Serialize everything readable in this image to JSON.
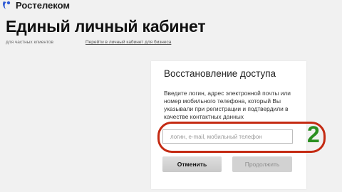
{
  "header": {
    "logo_text": "Ростелеком",
    "title": "Единый личный кабинет",
    "sub_left": "для частных клиентов",
    "sub_right_link": "Перейти в личный кабинет для бизнеса"
  },
  "recovery": {
    "title": "Восстановление доступа",
    "description": "Введите логин, адрес электронной почты или номер мобильного телефона, который Вы указывали при регистрации и подтвердили в качестве контактных данных",
    "input_placeholder": "логин, e-mail, мобильный телефон",
    "input_value": "",
    "cancel_label": "Отменить",
    "continue_label": "Продолжить"
  },
  "annotation": {
    "step_number": "2",
    "ring_color": "#c42a12",
    "digit_color": "#2a8f20"
  },
  "colors": {
    "brand": "#2f5bd6",
    "page_bg": "#f1f1f1"
  },
  "icons": {
    "logo": "rostelecom-logo-icon"
  }
}
